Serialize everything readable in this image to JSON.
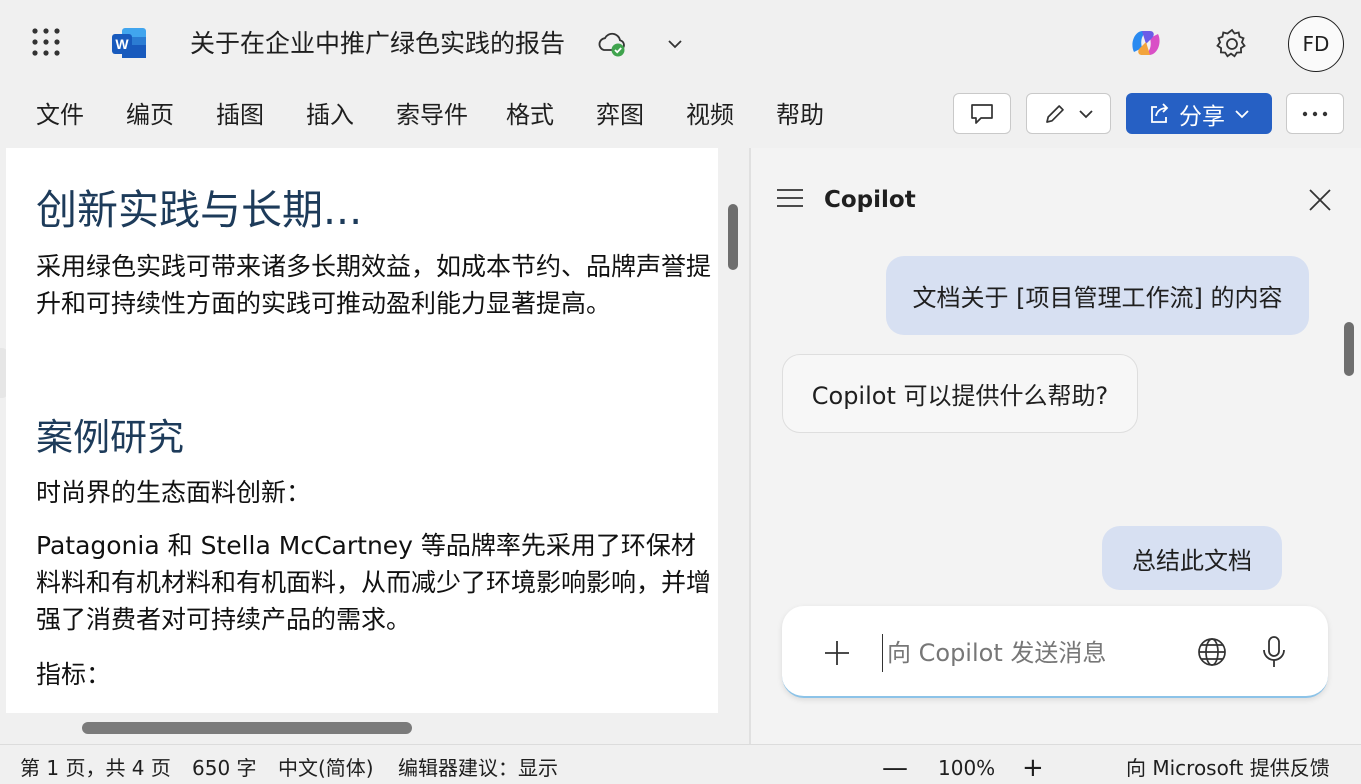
{
  "titlebar": {
    "doc_title": "关于在企业中推广绿色实践的报告",
    "avatar_initials": "FD",
    "icons": [
      "app-launcher-icon",
      "word-logo-icon",
      "cloud-saved-icon",
      "chevron-down-icon",
      "copilot-logo-icon",
      "gear-icon"
    ]
  },
  "menu": {
    "items": [
      "文件",
      "编页",
      "插图",
      "插入",
      "索导件",
      "格式",
      "弈图",
      "视频",
      "帮助"
    ],
    "share_label": "分享"
  },
  "document": {
    "heading1": "创新实践与长期...",
    "para1": "采用绿色实践可带来诸多长期效益，如成本节约、品牌声誉提升和可持续性方面的实践可推动盈利能力显著提高。",
    "heading2": "案例研究",
    "sub1": "时尚界的生态面料创新：",
    "para2": "Patagonia 和 Stella McCartney 等品牌率先采用了环保材料料和有机材料和有机面料，从而减少了环境影响影响，并增强了消费者对可持续产品的需求。",
    "sub2": "指标："
  },
  "copilot": {
    "title": "Copilot",
    "messages": [
      {
        "role": "user",
        "text": "文档关于 [项目管理工作流] 的内容"
      },
      {
        "role": "assistant",
        "text": "Copilot 可以提供什么帮助?"
      },
      {
        "role": "user",
        "text": "总结此文档"
      }
    ],
    "composer_placeholder": "向 Copilot 发送消息"
  },
  "statusbar": {
    "page_info": "第 1 页，共 4 页",
    "word_count": "650 字",
    "language": "中文(简体)",
    "editor": "编辑器建议：显示",
    "zoom_out": "—",
    "zoom": "100%",
    "zoom_in": "+",
    "feedback": "向 Microsoft 提供反馈"
  },
  "colors": {
    "accent": "#2660c4",
    "heading": "#1d3b5a",
    "user_bubble": "#d7e0f2",
    "cloud_check": "#3fa34d"
  }
}
